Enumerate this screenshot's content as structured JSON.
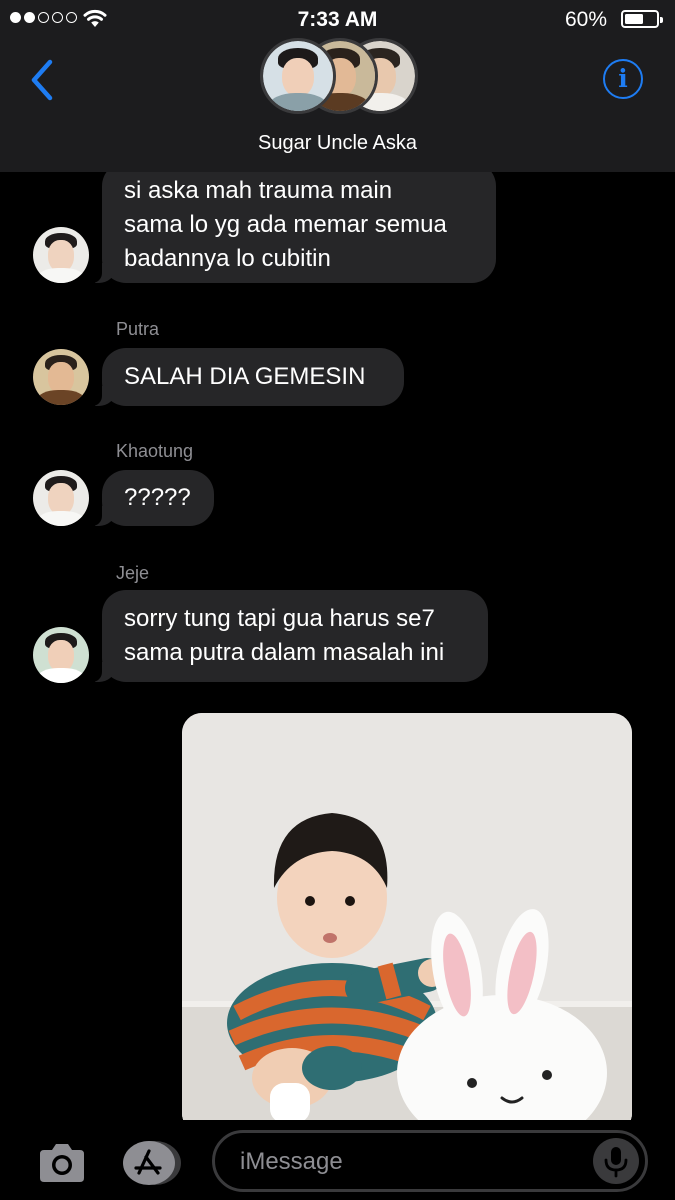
{
  "status_bar": {
    "time": "7:33 AM",
    "battery_percent_text": "60%",
    "battery_level": 0.6,
    "signal_bars": 2,
    "signal_total": 5
  },
  "header": {
    "group_name": "Sugar Uncle Aska",
    "back_icon": "chevron-left-icon",
    "info_icon": "info-icon",
    "accent_color": "#1e7cf2"
  },
  "messages": [
    {
      "sender": "",
      "text": "si aska mah trauma main\nsama lo yg ada memar semua\nbadannya lo cubitin"
    },
    {
      "sender": "Putra",
      "text": "SALAH DIA GEMESIN"
    },
    {
      "sender": "Khaotung",
      "text": "?????"
    },
    {
      "sender": "Jeje",
      "text": "sorry tung tapi gua harus se7\nsama putra dalam masalah ini"
    }
  ],
  "photo": {
    "icon": "photo-attachment"
  },
  "input": {
    "placeholder": "iMessage",
    "camera_icon": "camera-icon",
    "apps_icon": "app-store-icon",
    "mic_icon": "microphone-icon"
  },
  "colors": {
    "bubble_incoming": "#262628",
    "background": "#000000",
    "header_bg": "#1c1c1e"
  }
}
